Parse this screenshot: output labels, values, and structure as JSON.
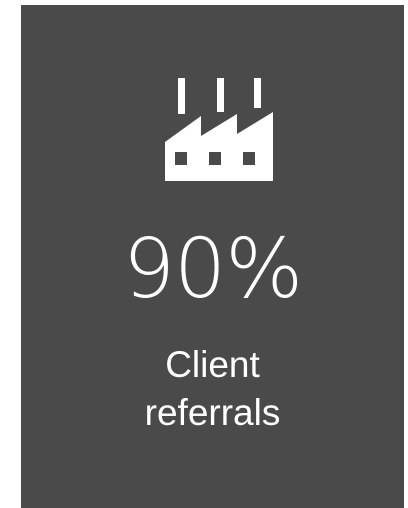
{
  "card": {
    "icon": "factory-icon",
    "stat_value": "90%",
    "caption_lines": [
      "Client",
      "referrals"
    ],
    "background_color": "#4a4a4a",
    "text_color": "#ffffff"
  }
}
